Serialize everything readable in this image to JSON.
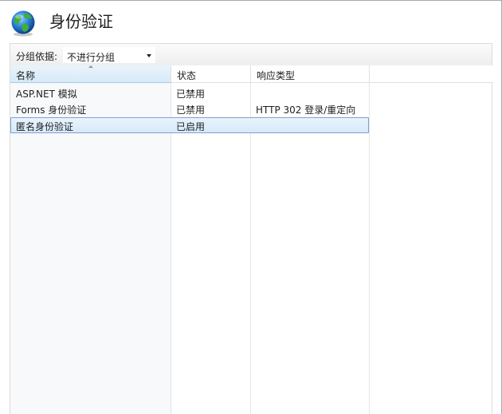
{
  "page_title": "身份验证",
  "toolbar": {
    "group_label": "分组依据:",
    "group_value": "不进行分组"
  },
  "columns": [
    "名称",
    "状态",
    "响应类型"
  ],
  "rows": [
    {
      "name": "ASP.NET 模拟",
      "status": "已禁用",
      "response": ""
    },
    {
      "name": "Forms 身份验证",
      "status": "已禁用",
      "response": "HTTP 302 登录/重定向"
    },
    {
      "name": "匿名身份验证",
      "status": "已启用",
      "response": ""
    }
  ],
  "selected_row": 2,
  "icon": "globe-icon",
  "colors": {
    "selection": "#d6e9f9",
    "selection_border": "#7da2ce"
  }
}
